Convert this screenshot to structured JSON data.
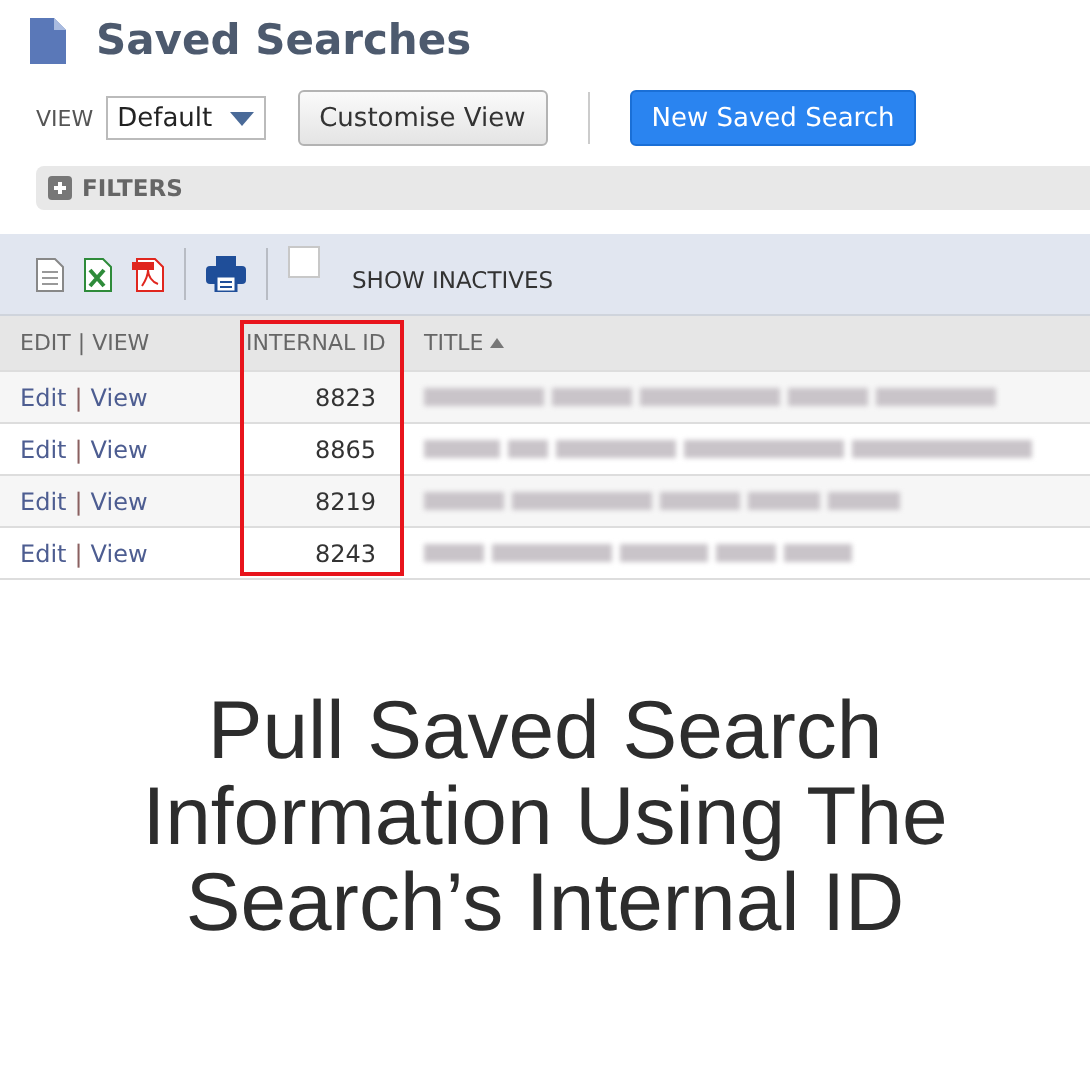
{
  "page_title": "Saved Searches",
  "view": {
    "label": "VIEW",
    "value": "Default"
  },
  "buttons": [
    {
      "label": "Customise View",
      "kind": "secondary"
    },
    {
      "label": "New Saved Search",
      "kind": "primary"
    }
  ],
  "filters": {
    "label": "FILTERS",
    "expanded": false
  },
  "show_inactives": {
    "label": "SHOW INACTIVES",
    "checked": false
  },
  "table": {
    "columns": [
      {
        "label": "EDIT | VIEW"
      },
      {
        "label": "INTERNAL ID"
      },
      {
        "label": "TITLE",
        "sorted": true
      }
    ],
    "rows": [
      {
        "edit": "Edit",
        "sep": "|",
        "view": "View",
        "internal_id": "8823"
      },
      {
        "edit": "Edit",
        "sep": "|",
        "view": "View",
        "internal_id": "8865"
      },
      {
        "edit": "Edit",
        "sep": "|",
        "view": "View",
        "internal_id": "8219"
      },
      {
        "edit": "Edit",
        "sep": "|",
        "view": "View",
        "internal_id": "8243"
      }
    ]
  },
  "caption": [
    "Pull Saved Search",
    "Information Using The",
    "Search’s Internal ID"
  ]
}
